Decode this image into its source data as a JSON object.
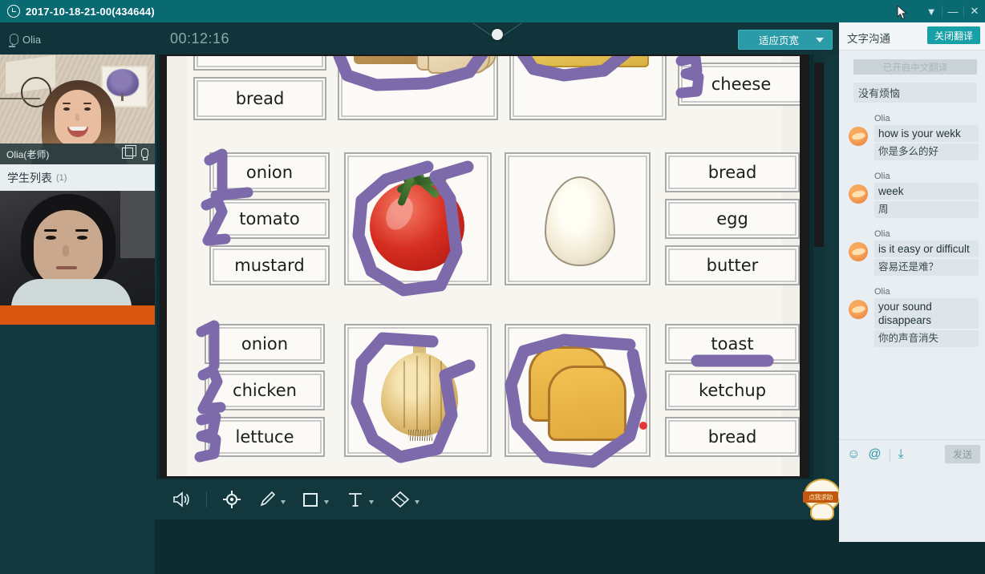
{
  "window": {
    "title": "2017-10-18-21-00(434644)",
    "clock_icon": "clock-icon",
    "collapse_icon": "chevron-down-icon",
    "minimize_icon": "minimize-icon",
    "close_icon": "close-icon"
  },
  "header": {
    "mic_icon": "microphone-icon",
    "teacher_name": "Olia",
    "session_time": "00:12:16",
    "fit_button_label": "适应页宽",
    "fit_button_caret": "chevron-down-icon"
  },
  "sidebar": {
    "teacher_video": {
      "label": "Olia(老师)",
      "window_icon": "duplicate-window-icon",
      "mic_icon": "microphone-icon"
    },
    "student_list": {
      "label": "学生列表",
      "count": "(1)"
    }
  },
  "whiteboard": {
    "scrollbar": "vertical-scrollbar",
    "cursor": "text-cursor",
    "rows": [
      {
        "left_words": [
          "",
          "bread"
        ],
        "left_image": "bread-loaf-image",
        "right_image": "cheese-image",
        "right_words": [
          "",
          "cheese"
        ],
        "annotations": [
          "circle-around-bread",
          "digit-3-next-to-cheese"
        ]
      },
      {
        "left_words": [
          "onion",
          "tomato",
          "mustard"
        ],
        "left_numbers": [
          "1",
          "2",
          ""
        ],
        "center_image": "tomato-image",
        "right_image": "egg-image",
        "right_words": [
          "bread",
          "egg",
          "butter"
        ],
        "annotations": [
          "circle-around-tomato"
        ]
      },
      {
        "left_words": [
          "onion",
          "chicken",
          "lettuce"
        ],
        "left_numbers": [
          "1",
          "2",
          "3"
        ],
        "center_image": "onion-image",
        "right_image": "toast-image",
        "right_words": [
          "toast",
          "ketchup",
          "bread"
        ],
        "annotations": [
          "circle-around-onion",
          "circle-around-toast",
          "underline-toast",
          "red-dot-marker"
        ]
      }
    ]
  },
  "toolbar": {
    "items": [
      {
        "name": "volume-icon",
        "label": "音量"
      },
      {
        "name": "pointer-target-icon",
        "label": "激光笔"
      },
      {
        "name": "pencil-icon",
        "label": "画笔"
      },
      {
        "name": "square-icon",
        "label": "形状"
      },
      {
        "name": "text-icon",
        "label": "文字"
      },
      {
        "name": "eraser-icon",
        "label": "橡皮擦"
      }
    ]
  },
  "mascot": {
    "label": "点我求助"
  },
  "chat": {
    "title": "文字沟通",
    "close_translate_label": "关闭翻译",
    "system_note": "已开启中文翻译",
    "first_message": "没有烦恼",
    "messages": [
      {
        "sender": "Olia",
        "en": "how is your wekk",
        "zh": "你是多么的好"
      },
      {
        "sender": "Olia",
        "en": "week",
        "zh": "周"
      },
      {
        "sender": "Olia",
        "en": "is it easy or difficult",
        "zh": "容易还是难？"
      },
      {
        "sender": "Olia",
        "en": "your sound disappears",
        "zh": "你的声音消失"
      }
    ],
    "tools": {
      "emoji_icon": "emoji-icon",
      "at_icon": "at-mention-icon",
      "download_icon": "download-icon",
      "send_label": "发送"
    }
  },
  "colors": {
    "title_bar": "#0a6a72",
    "app_bg": "#12383d",
    "accent": "#2b9ba8",
    "ink": "#7d6aab",
    "chat_bg": "#e8eef1",
    "marker_red": "#e03a36"
  }
}
